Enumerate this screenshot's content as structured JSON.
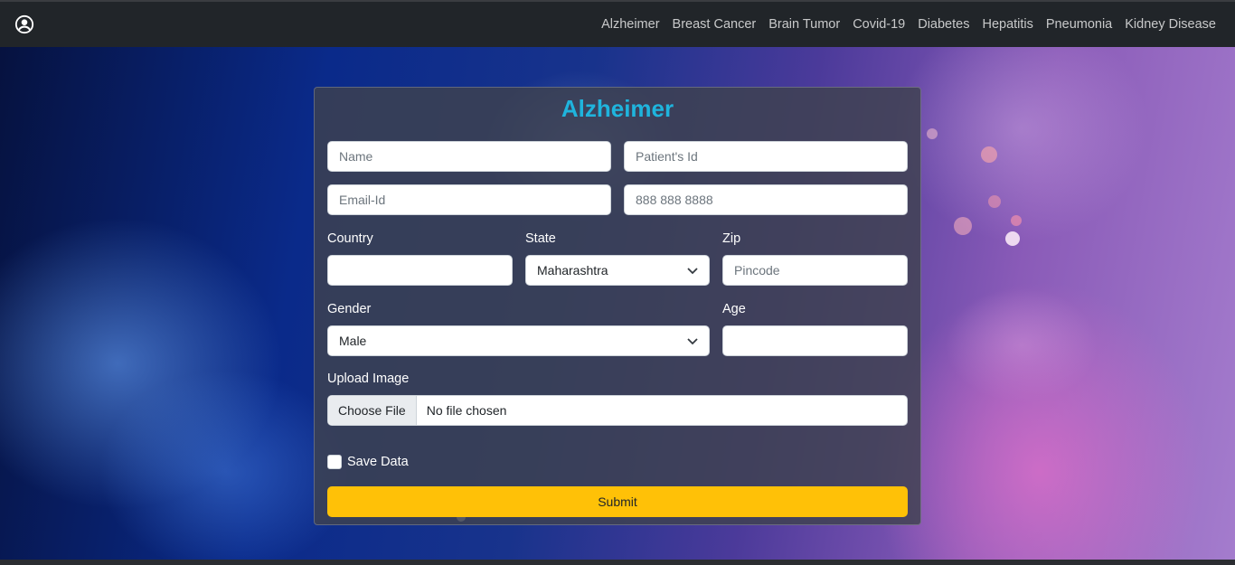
{
  "nav": {
    "links": [
      "Alzheimer",
      "Breast Cancer",
      "Brain Tumor",
      "Covid-19",
      "Diabetes",
      "Hepatitis",
      "Pneumonia",
      "Kidney Disease"
    ]
  },
  "form": {
    "title": "Alzheimer",
    "name_placeholder": "Name",
    "patient_id_placeholder": "Patient's Id",
    "email_placeholder": "Email-Id",
    "phone_placeholder": "888 888 8888",
    "country_label": "Country",
    "country_value": "",
    "state_label": "State",
    "state_value": "Maharashtra",
    "zip_label": "Zip",
    "zip_placeholder": "Pincode",
    "gender_label": "Gender",
    "gender_value": "Male",
    "age_label": "Age",
    "age_value": "",
    "upload_label": "Upload Image",
    "choose_file_label": "Choose File",
    "file_status": "No file chosen",
    "save_data_label": "Save Data",
    "save_data_checked": false,
    "submit_label": "Submit"
  },
  "colors": {
    "title": "#1fb4dd",
    "submit": "#ffc107",
    "navbar": "#212529"
  },
  "icons": {
    "user": "user-circle-icon",
    "dropdown": "chevron-down-icon"
  }
}
